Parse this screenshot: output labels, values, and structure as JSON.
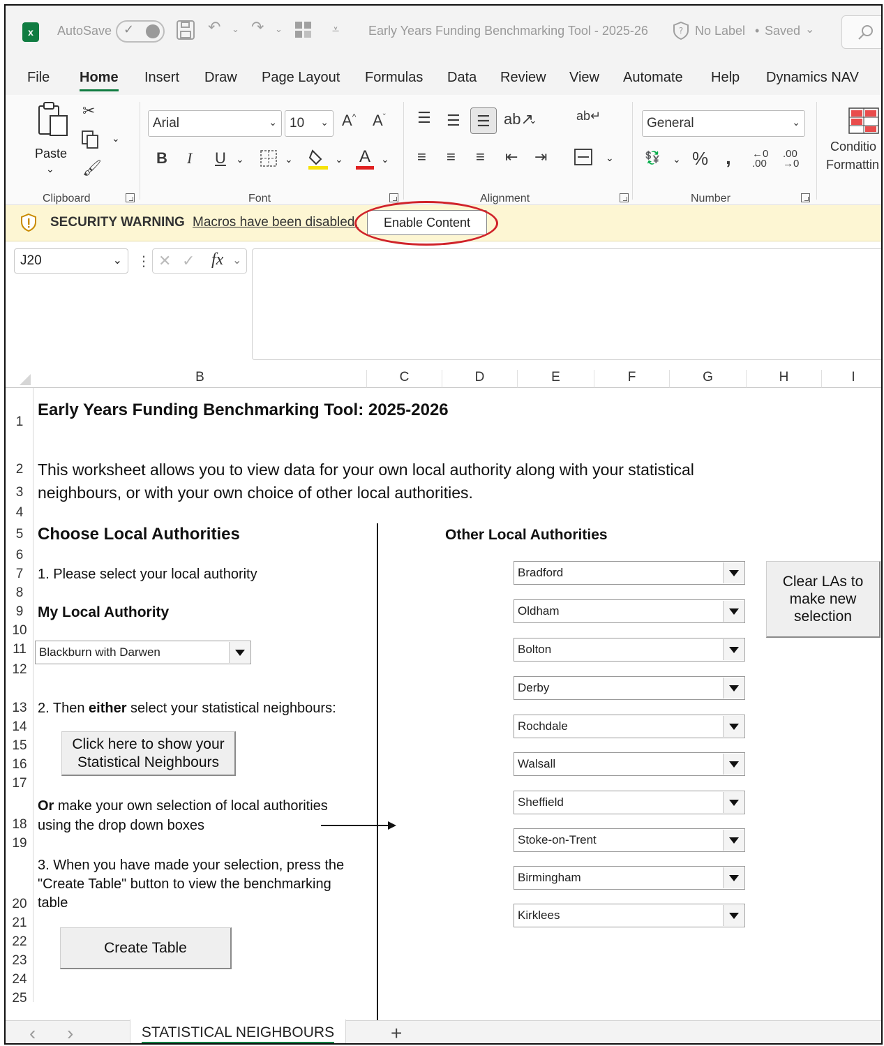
{
  "titlebar": {
    "autosave_label": "AutoSave",
    "doc_title": "Early Years Funding Benchmarking Tool - 2025-26",
    "label_status": "No Label",
    "separator": "•",
    "save_status": "Saved"
  },
  "menu": [
    "File",
    "Home",
    "Insert",
    "Draw",
    "Page Layout",
    "Formulas",
    "Data",
    "Review",
    "View",
    "Automate",
    "Help",
    "Dynamics NAV"
  ],
  "ribbon": {
    "clipboard": {
      "paste_label": "Paste",
      "group_label": "Clipboard"
    },
    "font": {
      "font_name": "Arial",
      "font_size": "10",
      "group_label": "Font"
    },
    "alignment": {
      "group_label": "Alignment"
    },
    "number": {
      "format": "General",
      "group_label": "Number"
    },
    "styles": {
      "conditional_label_1": "Conditio",
      "conditional_label_2": "Formattin"
    }
  },
  "security": {
    "title": "SECURITY WARNING",
    "message": "Macros have been disabled.",
    "button": "Enable Content",
    "highlight_color": "#d0232a"
  },
  "formula_bar": {
    "name_box": "J20",
    "fx": "fx"
  },
  "columns": [
    "B",
    "C",
    "D",
    "E",
    "F",
    "G",
    "H",
    "I"
  ],
  "rows": [
    "1",
    "2",
    "3",
    "4",
    "5",
    "6",
    "7",
    "8",
    "9",
    "10",
    "11",
    "12",
    "13",
    "14",
    "15",
    "16",
    "17",
    "18",
    "19",
    "20",
    "21",
    "22",
    "23",
    "24",
    "25"
  ],
  "sheet": {
    "title": "Early Years Funding Benchmarking Tool: 2025-2026",
    "intro_line1": "This worksheet allows you to view data for your own local authority along with your statistical",
    "intro_line2": "neighbours, or with your own choice of other local authorities.",
    "choose_heading": "Choose Local Authorities",
    "step1": "1. Please select your local authority",
    "my_la_label": "My Local Authority",
    "my_la_value": "Blackburn with Darwen",
    "step2_prefix": "2. Then ",
    "step2_bold": "either",
    "step2_suffix": " select your statistical neighbours:",
    "show_neighbours_button": [
      "Click here to show your",
      "Statistical Neighbours"
    ],
    "or_bold": "Or",
    "or_line1_suffix": " make your own selection of local authorities",
    "or_line2": "using the drop down boxes",
    "step3_line1": "3. When you have made your selection, press the",
    "step3_line2": "\"Create Table\" button to view the benchmarking",
    "step3_line3": "table",
    "create_table_button": "Create Table",
    "other_heading": "Other Local Authorities",
    "other_las": [
      "Bradford",
      "Oldham",
      "Bolton",
      "Derby",
      "Rochdale",
      "Walsall",
      "Sheffield",
      "Stoke-on-Trent",
      "Birmingham",
      "Kirklees"
    ],
    "clear_button": [
      "Clear LAs to",
      "make new",
      "selection"
    ]
  },
  "tabs": {
    "active": "STATISTICAL NEIGHBOURS",
    "add": "+",
    "prev": "‹",
    "next": "›"
  },
  "colors": {
    "accent": "#107c41",
    "warning_bg": "#fdf6d3"
  }
}
